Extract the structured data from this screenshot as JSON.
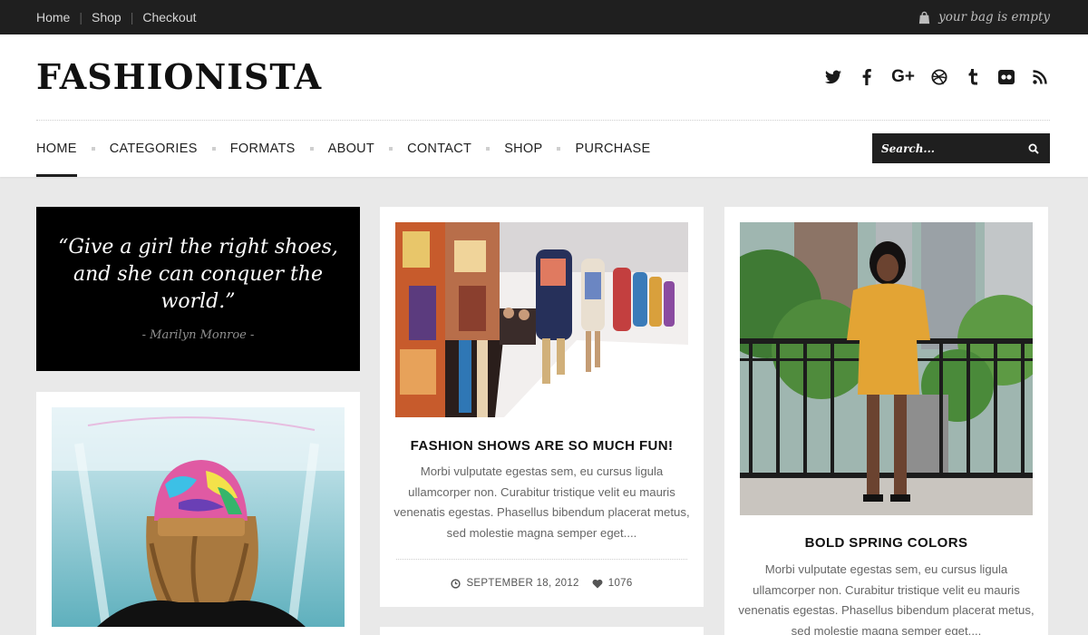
{
  "topbar": {
    "nav": [
      "Home",
      "Shop",
      "Checkout"
    ],
    "bag_text": "your bag is empty"
  },
  "header": {
    "logo": "FASHIONISTA",
    "social_icons": [
      "twitter-icon",
      "facebook-icon",
      "google-plus-icon",
      "dribbble-icon",
      "tumblr-icon",
      "flickr-icon",
      "rss-icon"
    ],
    "nav": [
      "HOME",
      "CATEGORIES",
      "FORMATS",
      "ABOUT",
      "CONTACT",
      "SHOP",
      "PURCHASE"
    ],
    "active_nav": "HOME",
    "search_placeholder": "Search..."
  },
  "quote": {
    "text": "“Give a girl the right shoes, and she can conquer the world.”",
    "author": "- Marilyn Monroe -"
  },
  "posts": [
    {
      "title": "FASHION SHOWS ARE SO MUCH FUN!",
      "excerpt": "Morbi vulputate egestas sem, eu cursus ligula ullamcorper non. Curabitur tristique velit eu mauris venenatis egestas. Phasellus bibendum placerat metus, sed molestie magna semper eget....",
      "date": "SEPTEMBER 18, 2012",
      "likes": "1076"
    },
    {
      "title": "BOLD SPRING COLORS",
      "excerpt": "Morbi vulputate egestas sem, eu cursus ligula ullamcorper non. Curabitur tristique velit eu mauris venenatis egestas. Phasellus bibendum placerat metus, sed molestie magna semper eget...."
    }
  ],
  "colors": {
    "dark": "#1f1f1f",
    "page_bg": "#e9e9e9",
    "text_muted": "#666666"
  }
}
